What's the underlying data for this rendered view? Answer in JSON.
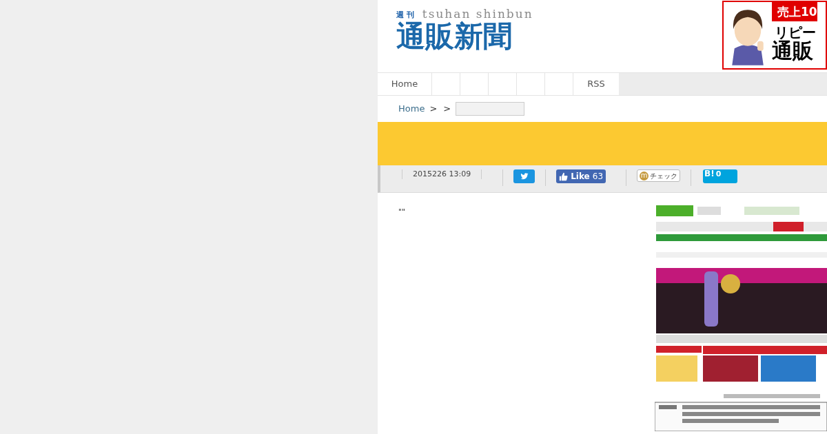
{
  "header": {
    "logo": {
      "kicker": "週 刊",
      "romaji": "tsuhan shinbun",
      "title": "通販新聞"
    },
    "banner": {
      "kind": "picture",
      "lines": [
        "売上10",
        "リピー",
        "通販"
      ]
    }
  },
  "nav": {
    "items": [
      {
        "label": "Home"
      },
      {
        "label": "RSS"
      }
    ]
  },
  "breadcrumb": {
    "home": "Home",
    "separators": [
      ">",
      ">"
    ]
  },
  "share_bar": {
    "date": "2015226 13:09",
    "like": {
      "label": "Like",
      "count": "63"
    },
    "check": {
      "icon_letter": "m",
      "label": "チェック"
    },
    "hatena": {
      "label": "B!",
      "count": "0"
    }
  },
  "article": {
    "body": "\"\""
  }
}
